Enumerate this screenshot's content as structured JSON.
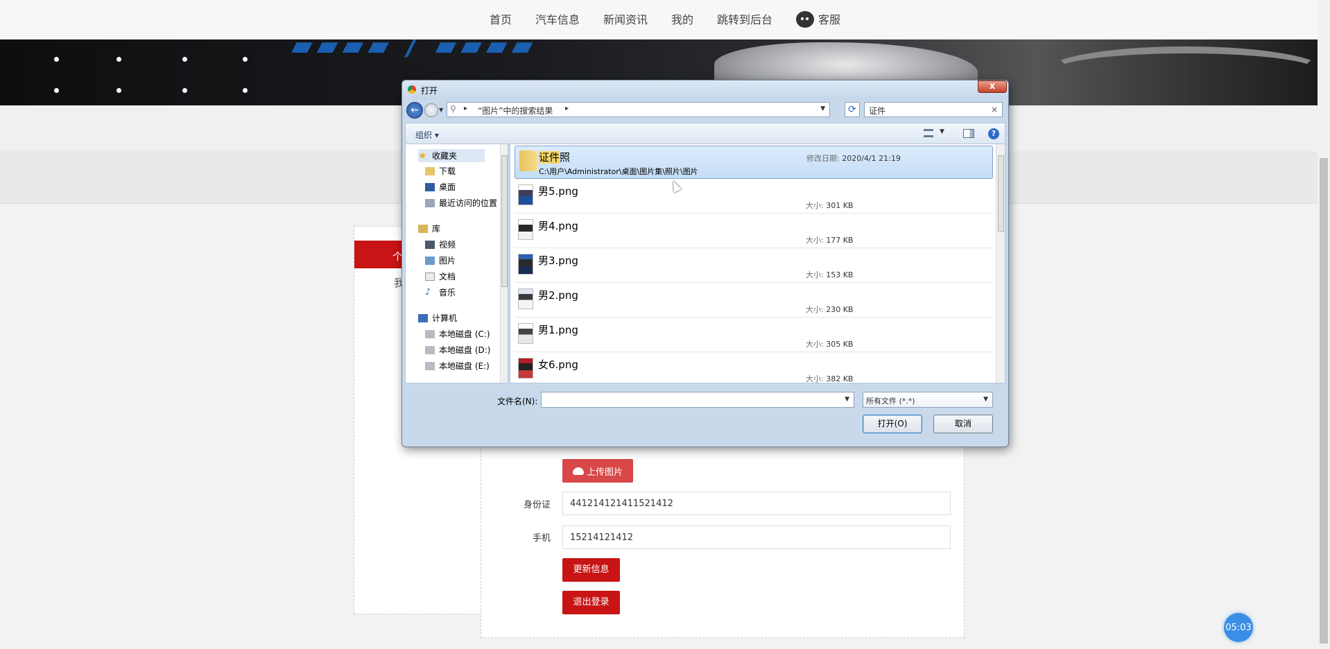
{
  "nav": {
    "items": [
      "首页",
      "汽车信息",
      "新闻资讯",
      "我的",
      "跳转到后台"
    ],
    "kefu": "客服"
  },
  "side": {
    "tab_label": "个",
    "text": "我"
  },
  "form": {
    "upload_label": "上传图片",
    "id_label": "身份证",
    "id_value": "441214121411521412",
    "phone_label": "手机",
    "phone_value": "15214121412",
    "update_label": "更新信息",
    "logout_label": "退出登录"
  },
  "timer": "05:03",
  "dialog": {
    "title": "打开",
    "close": "x",
    "address": "“图片”中的搜索结果",
    "search": "证件",
    "toolbar_org": "组织",
    "nav_items": [
      {
        "label": "收藏夹",
        "icon": "star-icon"
      },
      {
        "label": "下载",
        "icon": "download-folder-icon"
      },
      {
        "label": "桌面",
        "icon": "desktop-icon"
      },
      {
        "label": "最近访问的位置",
        "icon": "recent-places-icon"
      },
      {
        "label": "库",
        "icon": "library-icon"
      },
      {
        "label": "视频",
        "icon": "video-icon"
      },
      {
        "label": "图片",
        "icon": "pictures-icon"
      },
      {
        "label": "文档",
        "icon": "documents-icon"
      },
      {
        "label": "音乐",
        "icon": "music-icon"
      },
      {
        "label": "计算机",
        "icon": "computer-icon"
      },
      {
        "label": "本地磁盘 (C:)",
        "icon": "drive-icon"
      },
      {
        "label": "本地磁盘 (D:)",
        "icon": "drive-icon"
      },
      {
        "label": "本地磁盘 (E:)",
        "icon": "drive-icon"
      }
    ],
    "folder": {
      "name_highlight": "证件",
      "name_rest": "照",
      "path": "C:\\用户\\Administrator\\桌面\\图片集\\照片\\图片",
      "date_key": "修改日期:",
      "date_value": "2020/4/1 21:19"
    },
    "size_key": "大小:",
    "files": [
      {
        "name": "男5.png",
        "size": "301 KB"
      },
      {
        "name": "男4.png",
        "size": "177 KB"
      },
      {
        "name": "男3.png",
        "size": "153 KB"
      },
      {
        "name": "男2.png",
        "size": "230 KB"
      },
      {
        "name": "男1.png",
        "size": "305 KB"
      },
      {
        "name": "女6.png",
        "size": "382 KB"
      }
    ],
    "filename_label": "文件名(N):",
    "filename_value": "",
    "filetype": "所有文件 (*.*)",
    "open_label": "打开(O)",
    "cancel_label": "取消"
  }
}
